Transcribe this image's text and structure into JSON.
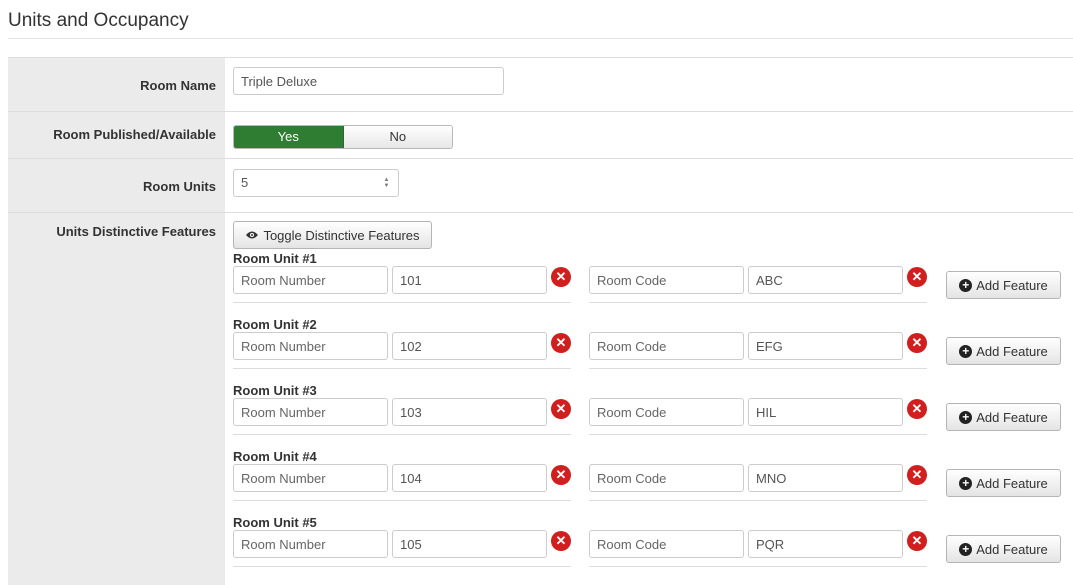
{
  "page_title": "Units and Occupancy",
  "room_name": {
    "label": "Room Name",
    "value": "Triple Deluxe"
  },
  "published": {
    "label": "Room Published/Available",
    "options": [
      "Yes",
      "No"
    ],
    "selected": "Yes"
  },
  "room_units": {
    "label": "Room Units",
    "value": "5"
  },
  "features": {
    "label": "Units Distinctive Features",
    "toggle_button": "Toggle Distinctive Features",
    "units": [
      {
        "title": "Room Unit #1",
        "label1": "Room Number",
        "value1": "101",
        "label2": "Room Code",
        "value2": "ABC",
        "add_label": "Add Feature"
      },
      {
        "title": "Room Unit #2",
        "label1": "Room Number",
        "value1": "102",
        "label2": "Room Code",
        "value2": "EFG",
        "add_label": "Add Feature"
      },
      {
        "title": "Room Unit #3",
        "label1": "Room Number",
        "value1": "103",
        "label2": "Room Code",
        "value2": "HIL",
        "add_label": "Add Feature"
      },
      {
        "title": "Room Unit #4",
        "label1": "Room Number",
        "value1": "104",
        "label2": "Room Code",
        "value2": "MNO",
        "add_label": "Add Feature"
      },
      {
        "title": "Room Unit #5",
        "label1": "Room Number",
        "value1": "105",
        "label2": "Room Code",
        "value2": "PQR",
        "add_label": "Add Feature"
      }
    ]
  },
  "colors": {
    "accent_green": "#2f7d32",
    "remove_red": "#d01f1f",
    "label_bg": "#ebebeb"
  },
  "icons": {
    "toggle": "eye-icon",
    "add": "plus-circle-icon",
    "remove": "remove-icon"
  }
}
